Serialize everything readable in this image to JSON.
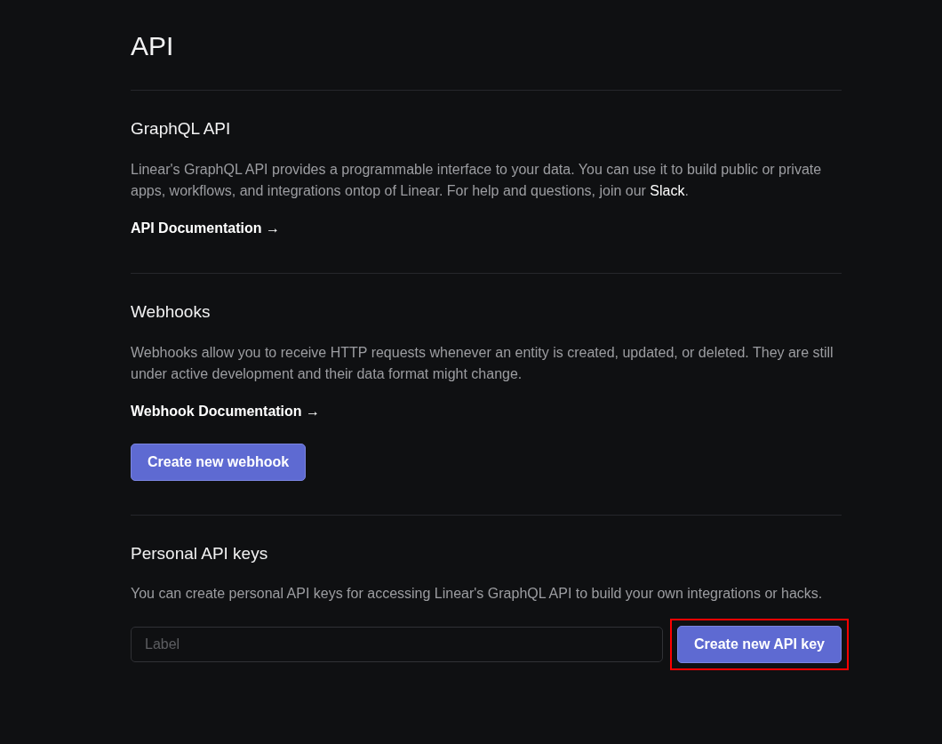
{
  "page_title": "API",
  "sections": [
    {
      "kind": "docs",
      "title": "GraphQL API",
      "description": "Linear's GraphQL API provides a programmable interface to your data. You can use it to build public or private apps, workflows, and integrations ontop of Linear. For help and questions, join our ",
      "description_link": "Slack",
      "description_end": ".",
      "doc_link": "API Documentation →"
    },
    {
      "kind": "docs",
      "title": "Webhooks",
      "description": "Webhooks allow you to receive HTTP requests whenever an entity is created, updated, or deleted. They are still under active development and their data format might change.",
      "doc_link": "Webhook Documentation →",
      "button": {
        "label": "Create new webhook",
        "highlighted": false
      }
    },
    {
      "kind": "keys",
      "title": "Personal API keys",
      "description": "You can create personal API keys for accessing Linear's GraphQL API to build your own integrations or hacks.",
      "field": {
        "placeholder": "Label"
      },
      "button": {
        "label": "Create new API key",
        "highlighted": true
      }
    }
  ]
}
